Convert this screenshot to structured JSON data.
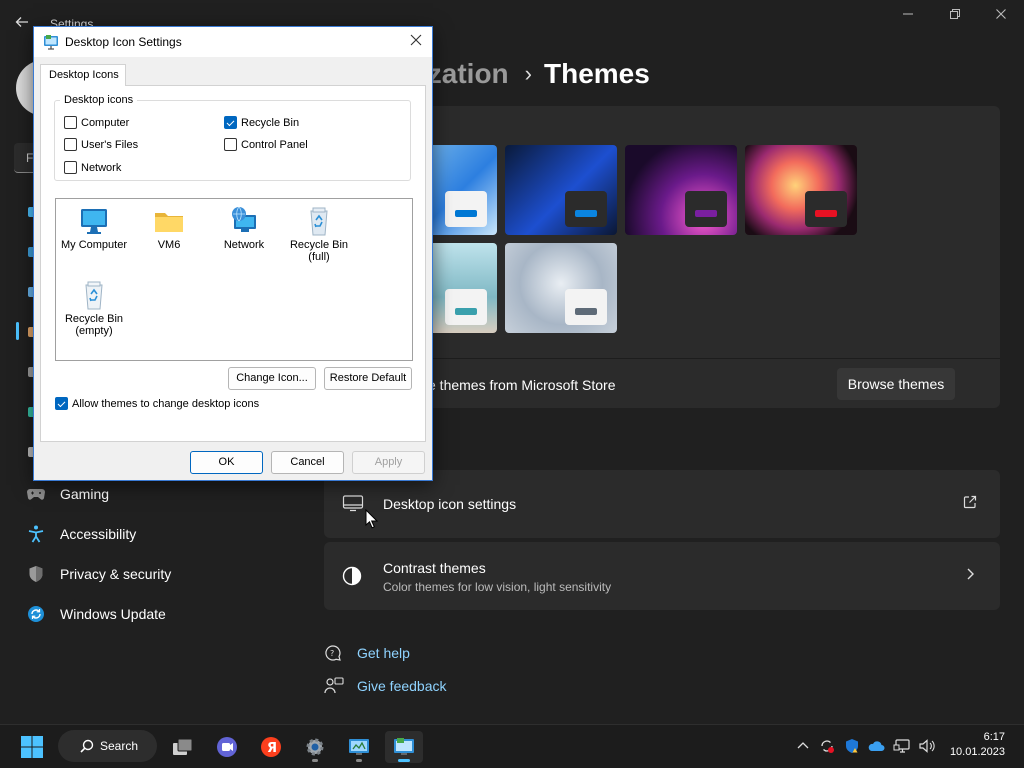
{
  "settings": {
    "app_title": "Settings",
    "breadcrumb": {
      "parent": "ization",
      "separator": "›",
      "current": "Themes"
    },
    "find_box_text": "F",
    "nav": [
      {
        "label": "Gaming",
        "icon": "gamepad-icon"
      },
      {
        "label": "Accessibility",
        "icon": "accessibility-icon"
      },
      {
        "label": "Privacy & security",
        "icon": "shield-icon"
      },
      {
        "label": "Windows Update",
        "icon": "update-icon"
      }
    ],
    "themes": {
      "store_text": "e themes from Microsoft Store",
      "browse_button": "Browse themes",
      "tiles": [
        "windows-light",
        "windows-dark",
        "glow",
        "captured-motion",
        "sunrise",
        "flow"
      ]
    },
    "rows": [
      {
        "title": "Desktop icon settings",
        "subtitle": "",
        "end_icon": "external-link-icon"
      },
      {
        "title": "Contrast themes",
        "subtitle": "Color themes for low vision, light sensitivity",
        "end_icon": "chevron-right-icon"
      }
    ],
    "links": [
      {
        "label": "Get help",
        "icon": "help-icon"
      },
      {
        "label": "Give feedback",
        "icon": "feedback-icon"
      }
    ]
  },
  "dialog": {
    "title": "Desktop Icon Settings",
    "tab": "Desktop Icons",
    "group_label": "Desktop icons",
    "checkboxes": [
      {
        "label": "Computer",
        "checked": false
      },
      {
        "label": "Recycle Bin",
        "checked": true
      },
      {
        "label": "User's Files",
        "checked": false
      },
      {
        "label": "Control Panel",
        "checked": false
      },
      {
        "label": "Network",
        "checked": false
      }
    ],
    "icons": [
      {
        "label": "My Computer",
        "label2": ""
      },
      {
        "label": "VM6",
        "label2": ""
      },
      {
        "label": "Network",
        "label2": ""
      },
      {
        "label": "Recycle Bin",
        "label2": "(full)"
      },
      {
        "label": "Recycle Bin",
        "label2": "(empty)"
      }
    ],
    "change_icon_button": "Change Icon...",
    "restore_default_button": "Restore Default",
    "allow_themes_label": "Allow themes to change desktop icons",
    "allow_themes_checked": true,
    "ok_button": "OK",
    "cancel_button": "Cancel",
    "apply_button": "Apply"
  },
  "taskbar": {
    "search_label": "Search",
    "time": "6:17",
    "date": "10.01.2023"
  },
  "colors": {
    "accent": "#4cc2ff",
    "link": "#8fd3ff",
    "dialog_accent": "#0067c0"
  }
}
